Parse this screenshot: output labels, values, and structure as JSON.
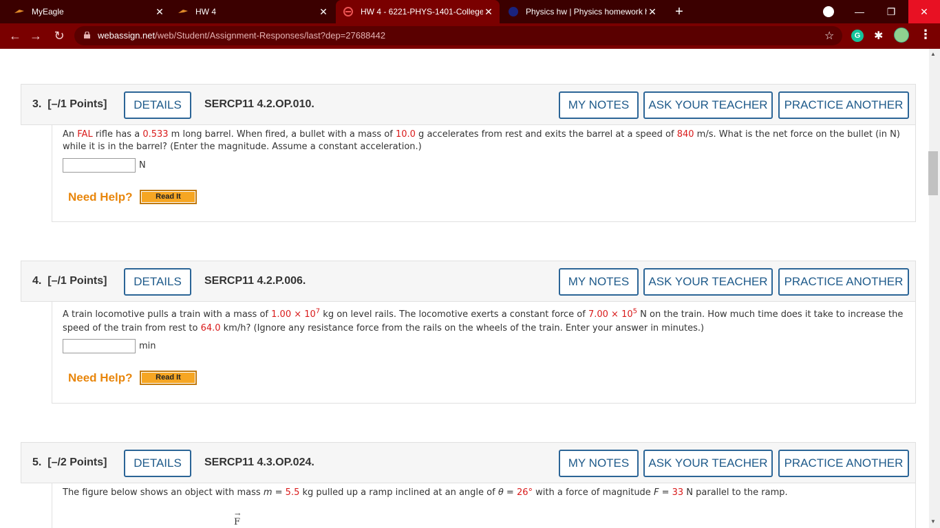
{
  "browser": {
    "tabs": [
      {
        "title": "MyEagle",
        "close": "✕"
      },
      {
        "title": "HW 4",
        "close": "✕"
      },
      {
        "title": "HW 4 - 6221-PHYS-1401-College",
        "close": "✕"
      },
      {
        "title": "Physics hw | Physics homework h",
        "close": "✕"
      }
    ],
    "new_tab": "+",
    "url_host": "webassign.net",
    "url_path": "/web/Student/Assignment-Responses/last?dep=27688442",
    "window": {
      "minimize": "—",
      "restore": "❐",
      "close": "✕"
    },
    "extension_g": "G"
  },
  "buttons": {
    "details": "DETAILS",
    "my_notes": "MY NOTES",
    "ask_teacher": "ASK YOUR TEACHER",
    "practice": "PRACTICE ANOTHER"
  },
  "help": {
    "need_help": "Need Help?",
    "read_it": "Read It"
  },
  "questions": [
    {
      "number": "3.",
      "points": "[–/1 Points]",
      "code": "SERCP11 4.2.OP.010.",
      "text": {
        "p1": "An ",
        "v1": "FAL",
        "p2": " rifle has a ",
        "v2": "0.533",
        "p3": " m long barrel. When fired, a bullet with a mass of ",
        "v3": "10.0",
        "p4": " g accelerates from rest and exits the barrel at a speed of ",
        "v4": "840",
        "p5": " m/s. What is the net force on the bullet (in N) while it is in the barrel? (Enter the magnitude. Assume a constant acceleration.)"
      },
      "unit": "N"
    },
    {
      "number": "4.",
      "points": "[–/1 Points]",
      "code": "SERCP11 4.2.P.006.",
      "text": {
        "p1": "A train locomotive pulls a train with a mass of ",
        "v1": "1.00 × 10",
        "e1": "7",
        "p2": " kg on level rails. The locomotive exerts a constant force of ",
        "v2": "7.00 × 10",
        "e2": "5",
        "p3": " N on the train. How much time does it take to increase the speed of the train from rest to ",
        "v3": "64.0",
        "p4": " km/h? (Ignore any resistance force from the rails on the wheels of the train. Enter your answer in minutes.)"
      },
      "unit": "min"
    },
    {
      "number": "5.",
      "points": "[–/2 Points]",
      "code": "SERCP11 4.3.OP.024.",
      "text": {
        "p1": "The figure below shows an object with mass ",
        "m": "m",
        "p2": " = ",
        "v1": "5.5",
        "p3": " kg pulled up a ramp inclined at an angle of ",
        "theta": "θ",
        "p4": " = ",
        "v2": "26°",
        "p5": " with a force of magnitude ",
        "f": "F",
        "p6": " = ",
        "v3": "33",
        "p7": " N parallel to the ramp."
      },
      "figure_label": "F"
    }
  ]
}
